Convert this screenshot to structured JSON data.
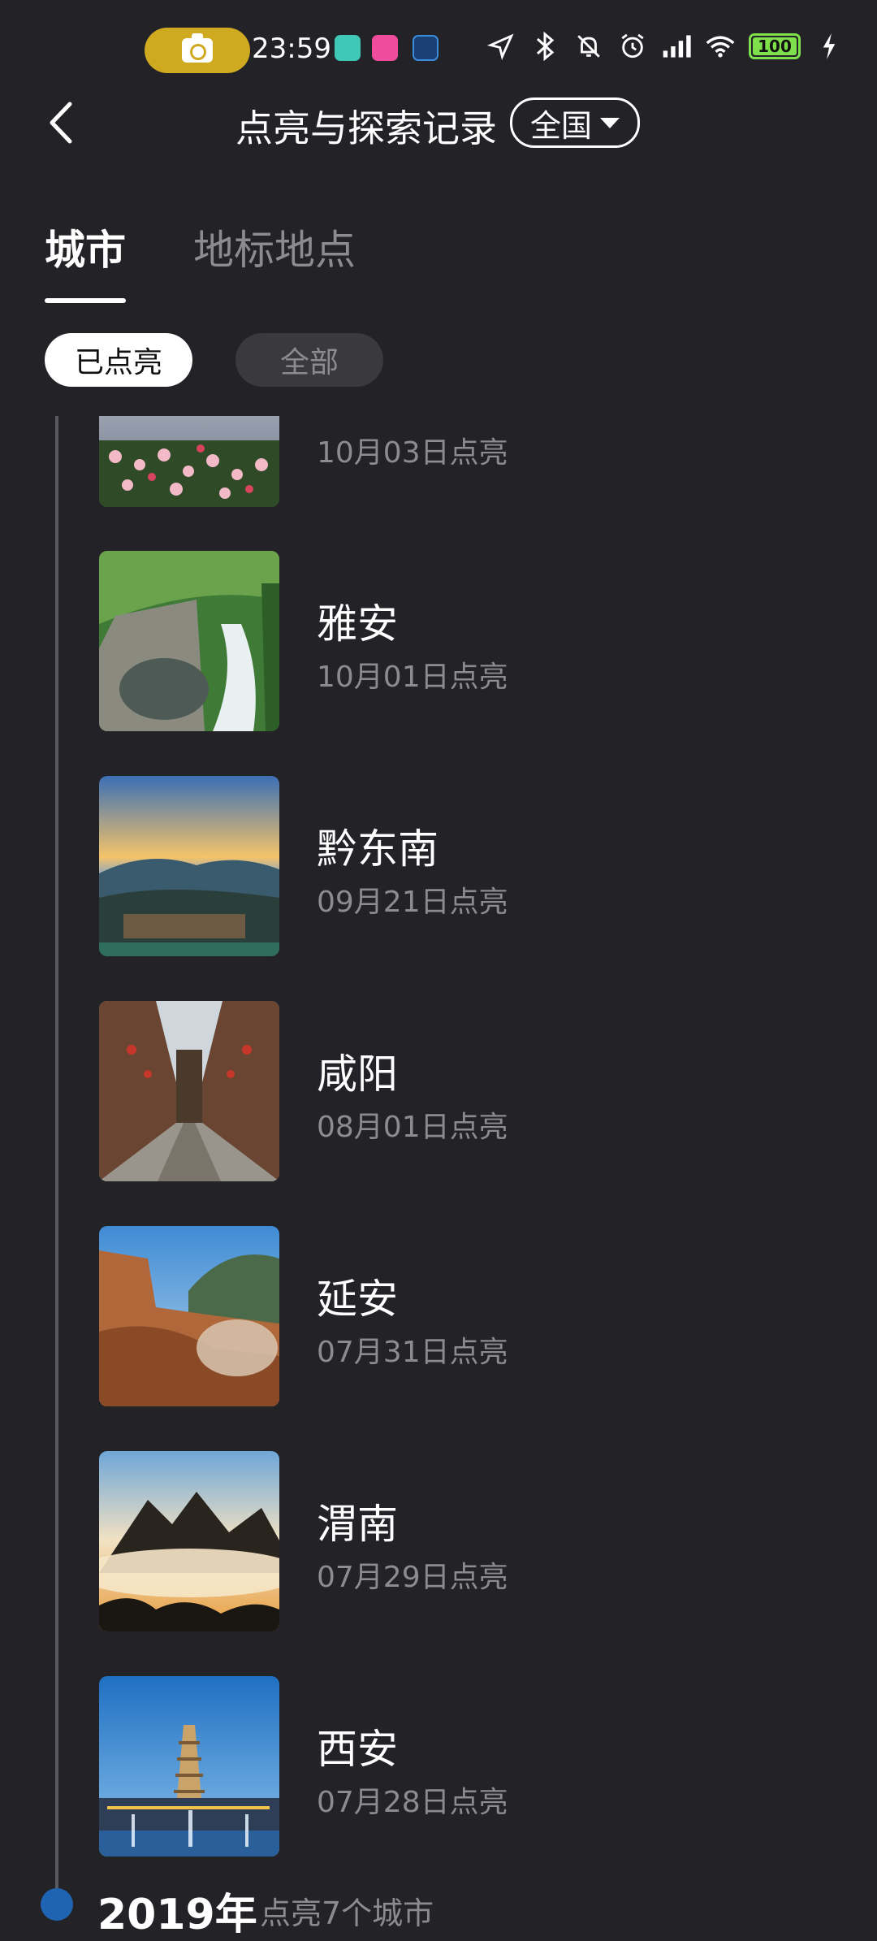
{
  "status_bar": {
    "time": "23:59",
    "battery": "100",
    "icons": [
      "camera-icon",
      "location-arrow-icon",
      "bluetooth-icon",
      "bell-off-icon",
      "alarm-icon",
      "signal-icon",
      "wifi-icon",
      "battery-icon",
      "charging-icon"
    ]
  },
  "header": {
    "title": "点亮与探索记录",
    "region": "全国"
  },
  "tabs": [
    {
      "label": "城市",
      "active": true
    },
    {
      "label": "地标地点",
      "active": false
    }
  ],
  "filters": [
    {
      "label": "已点亮",
      "active": true
    },
    {
      "label": "全部",
      "active": false
    }
  ],
  "cities": [
    {
      "name": "",
      "date": "10月03日点亮"
    },
    {
      "name": "雅安",
      "date": "10月01日点亮"
    },
    {
      "name": "黔东南",
      "date": "09月21日点亮"
    },
    {
      "name": "咸阳",
      "date": "08月01日点亮"
    },
    {
      "name": "延安",
      "date": "07月31日点亮"
    },
    {
      "name": "渭南",
      "date": "07月29日点亮"
    },
    {
      "name": "西安",
      "date": "07月28日点亮"
    }
  ],
  "year_section": {
    "year": "2019年",
    "summary": "点亮7个城市"
  },
  "colors": {
    "background": "#232227",
    "muted_text": "#8c8b8f",
    "camera_pill": "#cfa91f",
    "battery": "#7ee04b",
    "timeline_dot": "#1f63b3"
  }
}
